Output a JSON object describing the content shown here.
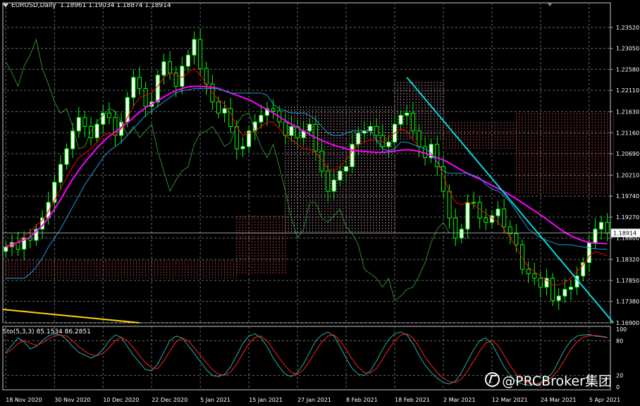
{
  "header": {
    "symbol": "EURUSD,Daily",
    "ohlc": "1.18961 1.19034 1.18874 1.18914"
  },
  "stochastic": {
    "label": "Sto(5,3,3) 85.1534 86.2851"
  },
  "current_price": "1.18914",
  "watermark": "@PRCBroker集团",
  "colors": {
    "bull": "#00ff00",
    "bear_body": "#000000",
    "bull_body": "#ffffff",
    "ma": "#ff00ff",
    "tenkan": "#ff0000",
    "kijun": "#1e9bd7",
    "chikou": "#2e8b2e",
    "cloud_bull": "#ffc0cb",
    "cloud_bear": "#ff6060",
    "trendline": "#00dcdc",
    "yellow_line": "#ffd700",
    "sto_main": "#20b2aa",
    "sto_signal": "#ff2020"
  },
  "chart_data": [
    {
      "type": "line",
      "title": "EURUSD,Daily",
      "xlim": [
        0,
        100
      ],
      "ylim": [
        1.169,
        1.2385
      ],
      "y_ticks": [
        "1.23520",
        "1.23050",
        "1.22580",
        "1.22110",
        "1.21630",
        "1.21160",
        "1.20690",
        "1.20210",
        "1.19740",
        "1.19270",
        "1.18800",
        "1.18320",
        "1.17850",
        "1.17380",
        "1.16900"
      ],
      "x_ticks": [
        {
          "x": 0,
          "label": "18 Nov 2020"
        },
        {
          "x": 8,
          "label": "30 Nov 2020"
        },
        {
          "x": 16,
          "label": "10 Dec 2020"
        },
        {
          "x": 24,
          "label": "22 Dec 2020"
        },
        {
          "x": 32,
          "label": "5 Jan 2021"
        },
        {
          "x": 40,
          "label": "15 Jan 2021"
        },
        {
          "x": 48,
          "label": "27 Jan 2021"
        },
        {
          "x": 56,
          "label": "8 Feb 2021"
        },
        {
          "x": 64,
          "label": "18 Feb 2021"
        },
        {
          "x": 72,
          "label": "2 Mar 2021"
        },
        {
          "x": 80,
          "label": "12 Mar 2021"
        },
        {
          "x": 88,
          "label": "24 Mar 2021"
        },
        {
          "x": 96,
          "label": "5 Apr 2021"
        }
      ],
      "grid": true,
      "closes": [
        1.186,
        1.187,
        1.1855,
        1.188,
        1.1875,
        1.19,
        1.1925,
        1.196,
        1.2005,
        1.2045,
        1.208,
        1.212,
        1.215,
        1.213,
        1.2105,
        1.2135,
        1.216,
        1.215,
        1.211,
        1.214,
        1.2195,
        1.224,
        1.2215,
        1.2175,
        1.2185,
        1.2245,
        1.2275,
        1.225,
        1.222,
        1.2265,
        1.229,
        1.2325,
        1.226,
        1.2225,
        1.2185,
        1.216,
        1.217,
        1.213,
        1.208,
        1.2085,
        1.212,
        1.214,
        1.2155,
        1.217,
        1.2165,
        1.214,
        1.211,
        1.213,
        1.2105,
        1.212,
        1.2135,
        1.2075,
        1.203,
        1.1985,
        1.201,
        1.203,
        1.204,
        1.209,
        1.2115,
        1.212,
        1.213,
        1.211,
        1.2085,
        1.2095,
        1.2135,
        1.2155,
        1.216,
        1.212,
        1.2085,
        1.206,
        1.209,
        1.204,
        1.1985,
        1.1925,
        1.188,
        1.19,
        1.196,
        1.196,
        1.1925,
        1.1915,
        1.193,
        1.1945,
        1.1905,
        1.189,
        1.1865,
        1.181,
        1.18,
        1.179,
        1.177,
        1.179,
        1.174,
        1.175,
        1.1765,
        1.177,
        1.1795,
        1.1825,
        1.187,
        1.19,
        1.1915,
        1.1891
      ],
      "series": [
        {
          "values": [
            1.186,
            1.1866,
            1.187,
            1.1876,
            1.1882,
            1.1895,
            1.1908,
            1.1925,
            1.1945,
            1.1966,
            1.199,
            1.2012,
            1.2032,
            1.205,
            1.2066,
            1.2082,
            1.2096,
            1.2108,
            1.2118,
            1.2128,
            1.2138,
            1.215,
            1.2162,
            1.2172,
            1.218,
            1.2188,
            1.2196,
            1.2204,
            1.221,
            1.2215,
            1.2219,
            1.222,
            1.222,
            1.2219,
            1.2218,
            1.2215,
            1.221,
            1.2205,
            1.22,
            1.2195,
            1.219,
            1.2183,
            1.2175,
            1.2168,
            1.216,
            1.2152,
            1.2143,
            1.2135,
            1.2128,
            1.212,
            1.2112,
            1.2105,
            1.2099,
            1.2093,
            1.2088,
            1.2084,
            1.208,
            1.2077,
            1.2075,
            1.2074,
            1.2073,
            1.2072,
            1.2072,
            1.2073,
            1.2075,
            1.2077,
            1.2078,
            1.2077,
            1.2074,
            1.207,
            1.2065,
            1.206,
            1.2055,
            1.2048,
            1.204,
            1.2032,
            1.2025,
            1.2018,
            1.2012,
            1.2005,
            1.1998,
            1.1991,
            1.1984,
            1.1976,
            1.1968,
            1.1959,
            1.195,
            1.1941,
            1.1932,
            1.1922,
            1.1912,
            1.1902,
            1.1893,
            1.1885,
            1.1879,
            1.1874,
            1.187,
            1.1868,
            1.1868,
            1.1867
          ]
        },
        {
          "values": [
            1.1865,
            1.186,
            1.1872,
            1.1885,
            1.1895,
            1.1908,
            1.192,
            1.194,
            1.1965,
            1.199,
            1.2015,
            1.204,
            1.206,
            1.207,
            1.208,
            1.2095,
            1.211,
            1.2115,
            1.211,
            1.2125,
            1.215,
            1.2175,
            1.2195,
            1.22,
            1.2205,
            1.222,
            1.224,
            1.225,
            1.2245,
            1.224,
            1.225,
            1.226,
            1.2245,
            1.2225,
            1.2205,
            1.219,
            1.218,
            1.216,
            1.213,
            1.211,
            1.2115,
            1.212,
            1.213,
            1.214,
            1.214,
            1.2125,
            1.211,
            1.21,
            1.209,
            1.208,
            1.208,
            1.207,
            1.2055,
            1.2035,
            1.203,
            1.204,
            1.2055,
            1.2075,
            1.209,
            1.2095,
            1.21,
            1.21,
            1.2095,
            1.2105,
            1.2115,
            1.2125,
            1.212,
            1.21,
            1.2085,
            1.208,
            1.207,
            1.205,
            1.202,
            1.1985,
            1.196,
            1.1955,
            1.196,
            1.1955,
            1.1945,
            1.1935,
            1.1925,
            1.1915,
            1.19,
            1.188,
            1.186,
            1.1835,
            1.1815,
            1.1805,
            1.1795,
            1.1785,
            1.1775,
            1.1775,
            1.178,
            1.179,
            1.1805,
            1.182,
            1.184,
            1.185,
            1.1845,
            1.184
          ]
        },
        {
          "values": [
            1.179,
            1.179,
            1.179,
            1.179,
            1.18,
            1.1815,
            1.1835,
            1.186,
            1.188,
            1.19,
            1.1925,
            1.195,
            1.1975,
            1.2,
            1.202,
            1.204,
            1.206,
            1.2075,
            1.2085,
            1.2095,
            1.211,
            1.2125,
            1.214,
            1.2155,
            1.2165,
            1.2175,
            1.2185,
            1.2195,
            1.2205,
            1.221,
            1.2212,
            1.2215,
            1.2215,
            1.2215,
            1.2215,
            1.2215,
            1.221,
            1.2205,
            1.2205,
            1.2205,
            1.2205,
            1.2205,
            1.2205,
            1.22,
            1.218,
            1.217,
            1.2165,
            1.216,
            1.216,
            1.216,
            1.2155,
            1.2145,
            1.213,
            1.2115,
            1.211,
            1.211,
            1.2115,
            1.212,
            1.212,
            1.212,
            1.212,
            1.21,
            1.208,
            1.2075,
            1.208,
            1.2095,
            1.2095,
            1.209,
            1.2085,
            1.208,
            1.207,
            1.205,
            1.203,
            1.2025,
            1.2025,
            1.2025,
            1.2025,
            1.202,
            1.2015,
            1.2,
            1.199,
            1.1985,
            1.1975,
            1.196,
            1.194,
            1.192,
            1.19,
            1.189,
            1.188,
            1.1875,
            1.187,
            1.1865,
            1.1865,
            1.1865,
            1.1862,
            1.186,
            1.1858,
            1.1856,
            1.1855,
            1.1855
          ]
        }
      ],
      "ichimoku_cloud": [
        {
          "x0": 0,
          "x1": 38,
          "top": 1.183,
          "bottom": 1.179
        },
        {
          "x0": 38,
          "x1": 46,
          "top": 1.193,
          "bottom": 1.18
        },
        {
          "x0": 46,
          "x1": 64,
          "top": 1.2175,
          "bottom": 1.189
        },
        {
          "x0": 64,
          "x1": 72,
          "top": 1.223,
          "bottom": 1.21
        },
        {
          "x0": 72,
          "x1": 84,
          "top": 1.214,
          "bottom": 1.208
        },
        {
          "x0": 84,
          "x1": 100,
          "top": 1.216,
          "bottom": 1.198
        }
      ],
      "trendline": {
        "from": [
          66,
          1.224
        ],
        "to": [
          100,
          1.169
        ]
      },
      "yellow_line": {
        "from": [
          0,
          1.172
        ],
        "to": [
          22,
          1.169
        ]
      }
    },
    {
      "type": "line",
      "title": "Sto(5,3,3) 85.1534 86.2851",
      "ylim": [
        0,
        100
      ],
      "y_ticks": [
        "100",
        "80",
        "20",
        "0"
      ],
      "series": [
        {
          "values": [
            60,
            72,
            85,
            78,
            66,
            70,
            80,
            88,
            92,
            90,
            82,
            70,
            60,
            55,
            50,
            55,
            65,
            80,
            90,
            86,
            70,
            55,
            42,
            30,
            28,
            40,
            60,
            80,
            88,
            85,
            72,
            58,
            44,
            30,
            20,
            18,
            22,
            35,
            55,
            75,
            88,
            92,
            85,
            70,
            50,
            35,
            22,
            18,
            25,
            40,
            60,
            80,
            90,
            95,
            88,
            70,
            50,
            32,
            22,
            20,
            28,
            45,
            65,
            82,
            92,
            95,
            90,
            75,
            55,
            38,
            25,
            15,
            8,
            5,
            10,
            25,
            45,
            65,
            80,
            85,
            75,
            55,
            35,
            20,
            10,
            5,
            3,
            4,
            8,
            15,
            25,
            45,
            65,
            80,
            88,
            90,
            91,
            88,
            87,
            85
          ]
        },
        {
          "values": [
            58,
            65,
            75,
            80,
            76,
            72,
            76,
            83,
            88,
            90,
            88,
            80,
            70,
            62,
            56,
            54,
            58,
            68,
            80,
            86,
            80,
            68,
            54,
            42,
            33,
            32,
            45,
            62,
            78,
            85,
            80,
            68,
            55,
            42,
            30,
            22,
            20,
            26,
            40,
            58,
            75,
            86,
            88,
            80,
            65,
            50,
            36,
            25,
            22,
            30,
            45,
            62,
            78,
            88,
            90,
            80,
            65,
            48,
            34,
            25,
            24,
            32,
            48,
            65,
            80,
            90,
            92,
            85,
            70,
            52,
            38,
            25,
            15,
            9,
            8,
            14,
            28,
            45,
            62,
            76,
            80,
            72,
            55,
            37,
            22,
            12,
            7,
            5,
            6,
            10,
            18,
            30,
            48,
            65,
            78,
            86,
            89,
            89,
            88,
            86
          ]
        }
      ]
    }
  ]
}
